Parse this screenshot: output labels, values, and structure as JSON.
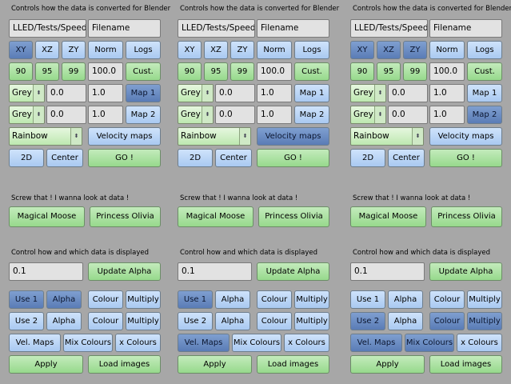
{
  "panels": [
    {
      "convert_label": "Controls how the data is converted for Blender",
      "path_value": "LLED/Tests/Speed/",
      "filename_value": "Filename",
      "axis_buttons": [
        "XY",
        "XZ",
        "ZY"
      ],
      "norm_label": "Norm",
      "logs_label": "Logs",
      "percent_buttons": [
        "90",
        "95",
        "99"
      ],
      "norm_value": "100.0",
      "cust_label": "Cust.",
      "map_rows": [
        {
          "select": "Grey",
          "value": "0.0",
          "scale": "1.0",
          "map_label": "Map 1"
        },
        {
          "select": "Grey",
          "value": "0.0",
          "scale": "1.0",
          "map_label": "Map 2"
        }
      ],
      "colormap_select": "Rainbow",
      "velocity_maps_label": "Velocity maps",
      "twod_label": "2D",
      "center_label": "Center",
      "go_label": "GO !",
      "screw_label": "Screw that ! I wanna look at data !",
      "magical_moose_label": "Magical Moose",
      "princess_olivia_label": "Princess Olivia",
      "display_label": "Control how and which data is displayed",
      "alpha_value": "0.1",
      "update_alpha_label": "Update Alpha",
      "use_rows": [
        {
          "use": "Use 1",
          "alpha": "Alpha",
          "colour": "Colour",
          "multiply": "Multiply"
        },
        {
          "use": "Use 2",
          "alpha": "Alpha",
          "colour": "Colour",
          "multiply": "Multiply"
        }
      ],
      "vel_maps_label": "Vel. Maps",
      "mix_colours_label": "Mix Colours",
      "x_colours_label": "x Colours",
      "apply_label": "Apply",
      "load_images_label": "Load images"
    },
    {
      "convert_label": "Controls how the data is converted for Blender",
      "path_value": "LLED/Tests/Speed/",
      "filename_value": "Filename",
      "axis_buttons": [
        "XY",
        "XZ",
        "ZY"
      ],
      "norm_label": "Norm",
      "logs_label": "Logs",
      "percent_buttons": [
        "90",
        "95",
        "99"
      ],
      "norm_value": "100.0",
      "cust_label": "Cust.",
      "map_rows": [
        {
          "select": "Grey",
          "value": "0.0",
          "scale": "1.0",
          "map_label": "Map 1"
        },
        {
          "select": "Grey",
          "value": "0.0",
          "scale": "1.0",
          "map_label": "Map 2"
        }
      ],
      "colormap_select": "Rainbow",
      "velocity_maps_label": "Velocity maps",
      "twod_label": "2D",
      "center_label": "Center",
      "go_label": "GO !",
      "screw_label": "Screw that ! I wanna look at data !",
      "magical_moose_label": "Magical Moose",
      "princess_olivia_label": "Princess Olivia",
      "display_label": "Control how and which data is displayed",
      "alpha_value": "0.1",
      "update_alpha_label": "Update Alpha",
      "use_rows": [
        {
          "use": "Use 1",
          "alpha": "Alpha",
          "colour": "Colour",
          "multiply": "Multiply"
        },
        {
          "use": "Use 2",
          "alpha": "Alpha",
          "colour": "Colour",
          "multiply": "Multiply"
        }
      ],
      "vel_maps_label": "Vel. Maps",
      "mix_colours_label": "Mix Colours",
      "x_colours_label": "x Colours",
      "apply_label": "Apply",
      "load_images_label": "Load images"
    },
    {
      "convert_label": "Controls how the data is converted for Blender",
      "path_value": "LLED/Tests/Speed/",
      "filename_value": "Filename",
      "axis_buttons": [
        "XY",
        "XZ",
        "ZY"
      ],
      "norm_label": "Norm",
      "logs_label": "Logs",
      "percent_buttons": [
        "90",
        "95",
        "99"
      ],
      "norm_value": "100.0",
      "cust_label": "Cust.",
      "map_rows": [
        {
          "select": "Grey",
          "value": "0.0",
          "scale": "1.0",
          "map_label": "Map 1"
        },
        {
          "select": "Grey",
          "value": "0.0",
          "scale": "1.0",
          "map_label": "Map 2"
        }
      ],
      "colormap_select": "Rainbow",
      "velocity_maps_label": "Velocity maps",
      "twod_label": "2D",
      "center_label": "Center",
      "go_label": "GO !",
      "screw_label": "Screw that ! I wanna look at data !",
      "magical_moose_label": "Magical Moose",
      "princess_olivia_label": "Princess Olivia",
      "display_label": "Control how and which data is displayed",
      "alpha_value": "0.1",
      "update_alpha_label": "Update Alpha",
      "use_rows": [
        {
          "use": "Use 1",
          "alpha": "Alpha",
          "colour": "Colour",
          "multiply": "Multiply"
        },
        {
          "use": "Use 2",
          "alpha": "Alpha",
          "colour": "Colour",
          "multiply": "Multiply"
        }
      ],
      "vel_maps_label": "Vel. Maps",
      "mix_colours_label": "Mix Colours",
      "x_colours_label": "x Colours",
      "apply_label": "Apply",
      "load_images_label": "Load images"
    }
  ],
  "colors": {
    "background": "#a7a7a7",
    "button_blue": "#b8d4f5",
    "button_active_blue": "#6a8cc4",
    "button_green": "#aee3a4",
    "field_grey": "#e2e2e2"
  }
}
